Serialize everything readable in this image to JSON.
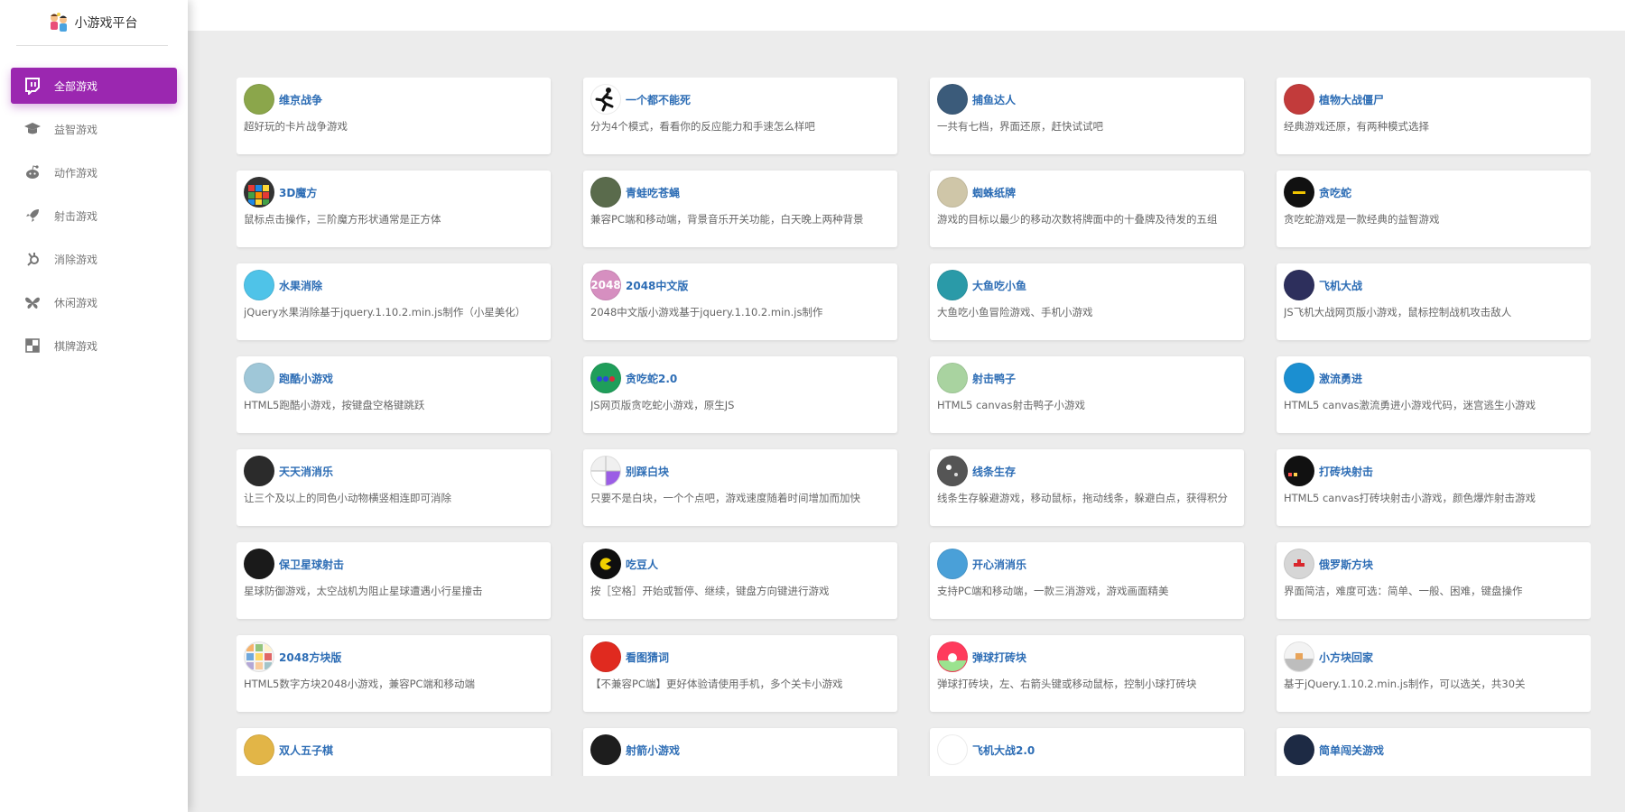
{
  "brand": {
    "title": "小游戏平台",
    "logo_icon": "kids-logo-icon"
  },
  "nav": [
    {
      "label": "全部游戏",
      "icon": "twitch-icon",
      "active": true
    },
    {
      "label": "益智游戏",
      "icon": "graduation-cap-icon"
    },
    {
      "label": "动作游戏",
      "icon": "reddit-icon"
    },
    {
      "label": "射击游戏",
      "icon": "rocket-icon"
    },
    {
      "label": "消除游戏",
      "icon": "hubspot-icon"
    },
    {
      "label": "休闲游戏",
      "icon": "butterfly-icon"
    },
    {
      "label": "棋牌游戏",
      "icon": "chessboard-icon"
    }
  ],
  "games": [
    {
      "title": "维京战争",
      "desc": "超好玩的卡片战争游戏",
      "icon": "viking-icon",
      "color": "#8ba64b"
    },
    {
      "title": "一个都不能死",
      "desc": "分为4个模式，看看你的反应能力和手速怎么样吧",
      "icon": "running-man-icon",
      "color": "#ffffff"
    },
    {
      "title": "捕鱼达人",
      "desc": "一共有七档，界面还原，赶快试试吧",
      "icon": "fish-icon",
      "color": "#3b5b7a"
    },
    {
      "title": "植物大战僵尸",
      "desc": "经典游戏还原，有两种模式选择",
      "icon": "popcap-icon",
      "color": "#c23b3b"
    },
    {
      "title": "3D魔方",
      "desc": "鼠标点击操作，三阶魔方形状通常是正方体",
      "icon": "rubiks-cube-icon",
      "color": "#333333"
    },
    {
      "title": "青蛙吃苍蝇",
      "desc": "兼容PC端和移动端，背景音乐开关功能，白天晚上两种背景",
      "icon": "frog-icon",
      "color": "#5a6b4c"
    },
    {
      "title": "蜘蛛纸牌",
      "desc": "游戏的目标以最少的移动次数将牌面中的十叠牌及待发的五组",
      "icon": "playing-cards-icon",
      "color": "#cfc6a8"
    },
    {
      "title": "贪吃蛇",
      "desc": "贪吃蛇游戏是一款经典的益智游戏",
      "icon": "snake-icon",
      "color": "#111111"
    },
    {
      "title": "水果消除",
      "desc": "jQuery水果消除基于jquery.1.10.2.min.js制作（小星美化）",
      "icon": "ice-cream-icon",
      "color": "#4fc3e8"
    },
    {
      "title": "2048中文版",
      "desc": "2048中文版小游戏基于jquery.1.10.2.min.js制作",
      "icon": "2048-icon",
      "color": "#d68fc0"
    },
    {
      "title": "大鱼吃小鱼",
      "desc": "大鱼吃小鱼冒险游戏、手机小游戏",
      "icon": "fish-eat-icon",
      "color": "#2a9aa8"
    },
    {
      "title": "飞机大战",
      "desc": "JS飞机大战网页版小游戏，鼠标控制战机攻击敌人",
      "icon": "fighter-plane-icon",
      "color": "#2d2f5c"
    },
    {
      "title": "跑酷小游戏",
      "desc": "HTML5跑酷小游戏，按键盘空格键跳跃",
      "icon": "parkour-icon",
      "color": "#9fc7d8"
    },
    {
      "title": "贪吃蛇2.0",
      "desc": "JS网页版贪吃蛇小游戏，原生JS",
      "icon": "snake-dots-icon",
      "color": "#1f9e5a"
    },
    {
      "title": "射击鸭子",
      "desc": "HTML5 canvas射击鸭子小游戏",
      "icon": "duck-icon",
      "color": "#a9d3a0"
    },
    {
      "title": "激流勇进",
      "desc": "HTML5 canvas激流勇进小游戏代码，迷宫逃生小游戏",
      "icon": "stairs-icon",
      "color": "#1b8fd1"
    },
    {
      "title": "天天消消乐",
      "desc": "让三个及以上的同色小动物横竖相连即可消除",
      "icon": "animals-icon",
      "color": "#2b2b2b"
    },
    {
      "title": "别踩白块",
      "desc": "只要不是白块，一个个点吧，游戏速度随着时间增加而加快",
      "icon": "tiles-icon",
      "color": "#f0f0f0"
    },
    {
      "title": "线条生存",
      "desc": "线条生存躲避游戏，移动鼠标，拖动线条，躲避白点，获得积分",
      "icon": "dots-icon",
      "color": "#555555"
    },
    {
      "title": "打砖块射击",
      "desc": "HTML5 canvas打砖块射击小游戏，颜色爆炸射击游戏",
      "icon": "brick-shooter-icon",
      "color": "#111111"
    },
    {
      "title": "保卫星球射击",
      "desc": "星球防御游戏，太空战机为阻止星球遭遇小行星撞击",
      "icon": "planet-icon",
      "color": "#1a1a1a"
    },
    {
      "title": "吃豆人",
      "desc": "按［空格］开始或暂停、继续，键盘方向键进行游戏",
      "icon": "pacman-icon",
      "color": "#0f0f0f"
    },
    {
      "title": "开心消消乐",
      "desc": "支持PC端和移动端，一款三消游戏，游戏画面精美",
      "icon": "candy-icon",
      "color": "#4aa0d8"
    },
    {
      "title": "俄罗斯方块",
      "desc": "界面简洁，难度可选：简单、一般、困难，键盘操作",
      "icon": "tetris-icon",
      "color": "#d6d6d6"
    },
    {
      "title": "2048方块版",
      "desc": "HTML5数字方块2048小游戏，兼容PC端和移动端",
      "icon": "grid-blocks-icon",
      "color": "#f4f4f4"
    },
    {
      "title": "看图猜词",
      "desc": "【不兼容PC端】更好体验请使用手机，多个关卡小游戏",
      "icon": "bottle-icon",
      "color": "#e02a1f"
    },
    {
      "title": "弹球打砖块",
      "desc": "弹球打砖块，左、右箭头键或移动鼠标，控制小球打砖块",
      "icon": "ball-bounce-icon",
      "color": "#ff3b5c"
    },
    {
      "title": "小方块回家",
      "desc": "基于jQuery.1.10.2.min.js制作，可以选关，共30关",
      "icon": "house-block-icon",
      "color": "#f3f3f3"
    },
    {
      "title": "双人五子棋",
      "desc": "",
      "icon": "gomoku-icon",
      "color": "#e2b547"
    },
    {
      "title": "射箭小游戏",
      "desc": "",
      "icon": "archery-icon",
      "color": "#1d1d1d"
    },
    {
      "title": "飞机大战2.0",
      "desc": "",
      "icon": "fighter-jet-icon",
      "color": "#ffffff"
    },
    {
      "title": "简单闯关游戏",
      "desc": "",
      "icon": "level-icon",
      "color": "#1d2a44"
    }
  ]
}
